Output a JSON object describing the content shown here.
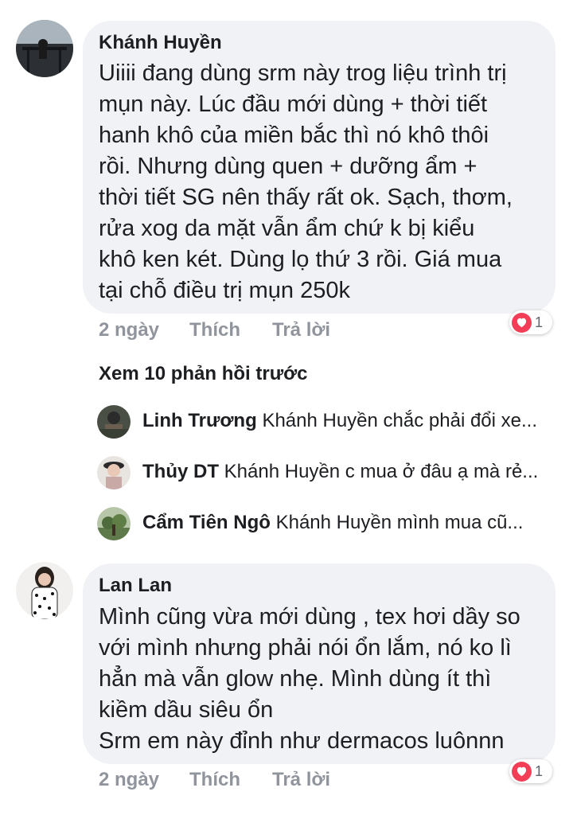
{
  "comments": [
    {
      "author": "Khánh Huyền",
      "text": "Uiiii đang dùng srm này trog liệu trình trị\nmụn này. Lúc đầu mới dùng + thời tiết\nhanh khô của miền bắc thì nó khô thôi\nrồi. Nhưng dùng quen + dưỡng ẩm +\nthời tiết SG nên thấy rất ok. Sạch, thơm,\nrửa xog da mặt vẫn ẩm chứ k bị kiểu\nkhô ken két. Dùng lọ thứ 3 rồi. Giá mua\ntại chỗ điều trị mụn 250k",
      "time": "2 ngày",
      "like_label": "Thích",
      "reply_label": "Trả lời",
      "reaction_count": "1"
    },
    {
      "author": "Lan Lan",
      "text": "Mình cũng vừa mới dùng , tex hơi dầy so\nvới mình nhưng phải nói ổn lắm, nó ko lì\nhẳn mà vẫn glow nhẹ. Mình dùng ít thì\nkiềm dầu siêu ổn\nSrm em này đỉnh như dermacos luônnn",
      "time": "2 ngày",
      "like_label": "Thích",
      "reply_label": "Trả lời",
      "reaction_count": "1"
    }
  ],
  "view_more_replies": "Xem 10 phản hồi trước",
  "replies": [
    {
      "name": "Linh Trương",
      "text": "Khánh Huyền chắc phải đổi xe..."
    },
    {
      "name": "Thủy DT",
      "text": "Khánh Huyền c mua ở đâu ạ mà rẻ..."
    },
    {
      "name": "Cẩm Tiên Ngô",
      "text": "Khánh Huyền  mình mua cũ..."
    }
  ],
  "icons": {
    "reaction": "heart-icon",
    "reaction_color": "#f33e58"
  }
}
